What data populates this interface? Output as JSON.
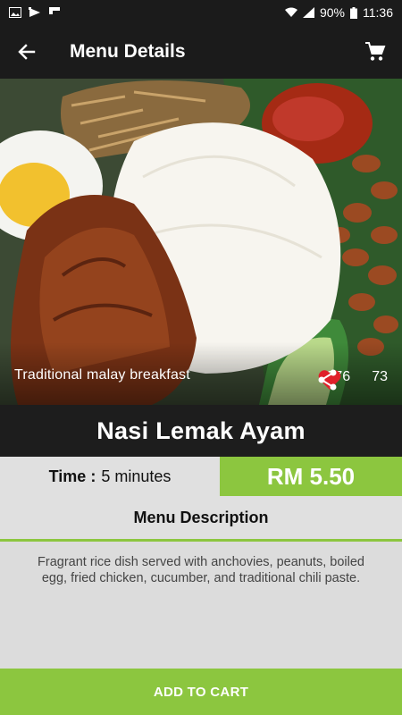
{
  "status_bar": {
    "battery": "90%",
    "time": "11:36",
    "icons": [
      "image-icon",
      "play-store-icon",
      "flipboard-icon",
      "wifi-icon",
      "signal-icon",
      "battery-icon"
    ]
  },
  "app_bar": {
    "title": "Menu Details",
    "back_icon": "arrow-back-icon",
    "cart_icon": "shopping-cart-icon"
  },
  "hero": {
    "caption": "Traditional malay breakfast",
    "likes": "376",
    "shares": "73",
    "like_icon": "heart-icon",
    "share_icon": "share-icon"
  },
  "dish": {
    "name": "Nasi Lemak Ayam"
  },
  "info": {
    "time_label": "Time :",
    "time_value": "5 minutes",
    "price": "RM 5.50"
  },
  "description": {
    "header": "Menu Description",
    "text": "Fragrant rice dish served with anchovies, peanuts, boiled egg, fried chicken, cucumber, and traditional chili paste."
  },
  "actions": {
    "add_to_cart": "ADD TO CART"
  },
  "colors": {
    "accent": "#8cc63f",
    "dark": "#1b1b1b",
    "background": "#dcdcdc",
    "heart": "#e0202a"
  }
}
